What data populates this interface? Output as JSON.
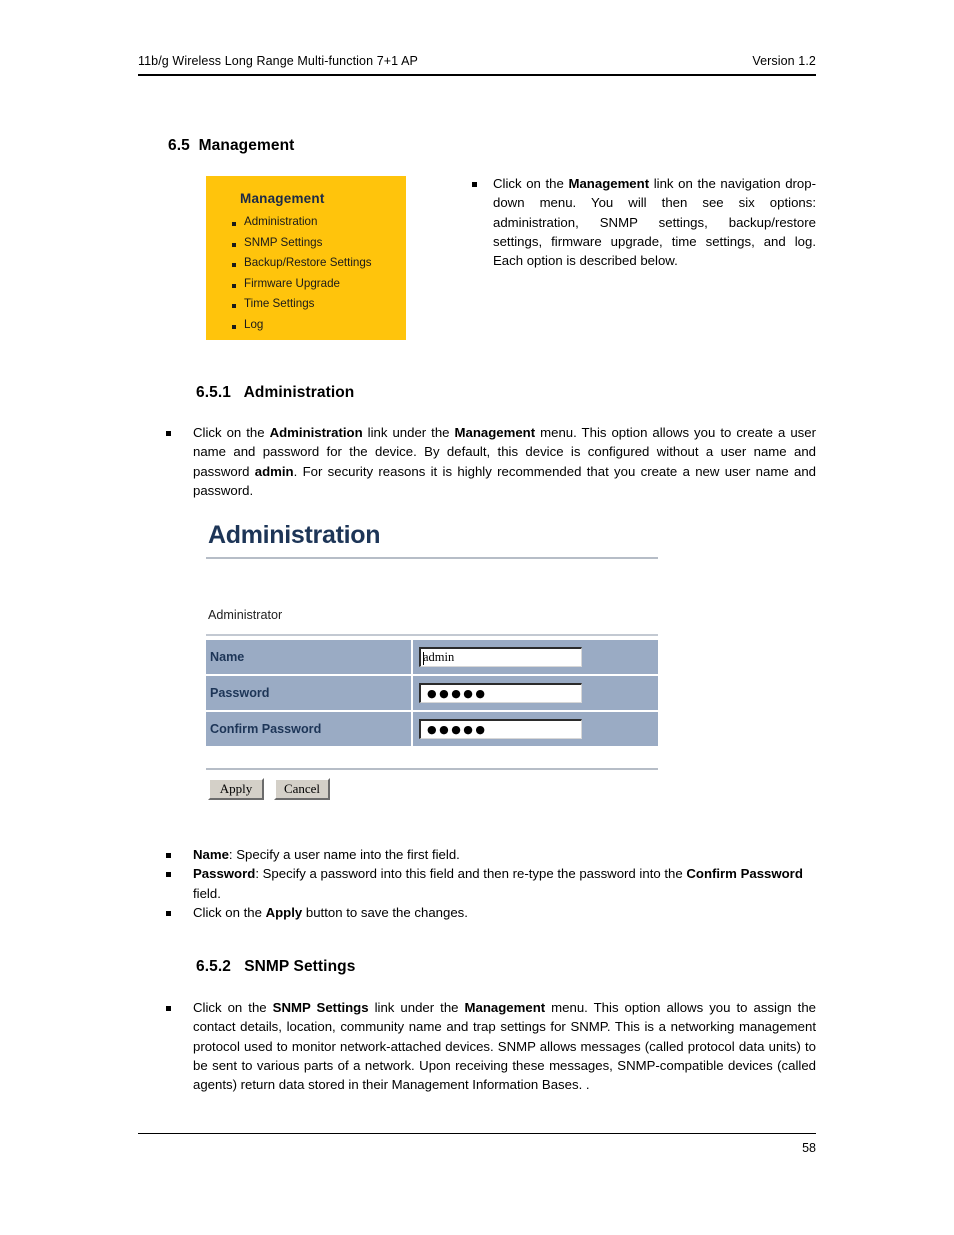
{
  "header": {
    "left": "11b/g Wireless Long Range Multi-function 7+1 AP",
    "right": "Version 1.2"
  },
  "footer": {
    "page_number": "58"
  },
  "sections": {
    "management": {
      "heading": "6.5  Management",
      "intro_html": "Click on the <b>Management</b> link on the navigation drop-down menu. You will then see six options: administration, SNMP settings, backup/restore settings, firmware upgrade, time settings, and log. Each option is described below."
    },
    "administration": {
      "heading": "6.5.1   Administration",
      "intro_html": "Click on the <b>Administration</b> link under the <b>Management</b> menu. This option allows you to create a user name and password for the device. By default, this device is configured without a user name and password <b>admin</b>. For security reasons it is highly recommended that you create a new user name and password."
    },
    "snmp": {
      "heading": "6.5.2   SNMP Settings",
      "intro_html": "Click on the <b>SNMP Settings</b> link under the <b>Management</b> menu. This option allows you to assign the contact details, location, community name and trap settings for SNMP. This is a networking management protocol used to monitor network-attached devices. SNMP allows messages (called protocol data units) to be sent to various parts of a network. Upon receiving these messages, SNMP-compatible devices (called agents) return data stored in their Management Information Bases. ."
    }
  },
  "menu_figure": {
    "title": "Management",
    "background_color": "#ffc40c",
    "title_color": "#1b2a47",
    "items": [
      {
        "label": "Administration"
      },
      {
        "label": "SNMP Settings"
      },
      {
        "label": "Backup/Restore Settings"
      },
      {
        "label": "Firmware Upgrade"
      },
      {
        "label": "Time Settings"
      },
      {
        "label": "Log"
      }
    ]
  },
  "admin_figure": {
    "title": "Administration",
    "title_color": "#1d3557",
    "section_label": "Administrator",
    "row_background_color": "#9aabc4",
    "fields": [
      {
        "label": "Name",
        "value": "admin",
        "type": "text"
      },
      {
        "label": "Password",
        "value": "●●●●●",
        "type": "password"
      },
      {
        "label": "Confirm Password",
        "value": "●●●●●",
        "type": "password"
      }
    ],
    "buttons": {
      "apply": "Apply",
      "cancel": "Cancel"
    }
  },
  "field_notes": [
    {
      "html": "<b>Name</b>: Specify a user name into the first field."
    },
    {
      "html": "<b>Password</b>: Specify a password into this field and then re-type the password into the <b>Confirm Password</b> field."
    },
    {
      "html": "Click on the <b>Apply</b> button to save the changes."
    }
  ]
}
